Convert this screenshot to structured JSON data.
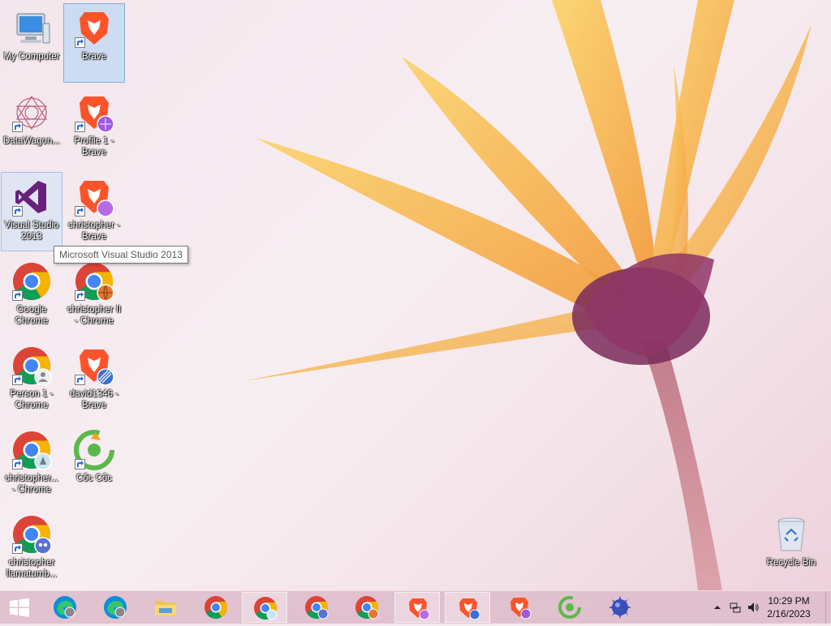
{
  "desktop": {
    "icons": [
      {
        "label": "My Computer"
      },
      {
        "label": "Brave"
      },
      {
        "label": "DataWagon..."
      },
      {
        "label": "Profile 1 - Brave"
      },
      {
        "label": "Visual Studio 2013"
      },
      {
        "label": "christopher - Brave"
      },
      {
        "label": "Google Chrome"
      },
      {
        "label": "christopher II - Chrome"
      },
      {
        "label": "Person 1 - Chrome"
      },
      {
        "label": "david1346 - Brave"
      },
      {
        "label": "christopher... - Chrome"
      },
      {
        "label": "Cốc Cốc"
      },
      {
        "label": "christopher llamatumb..."
      },
      {
        "label": "Recycle Bin"
      }
    ],
    "tooltip": "Microsoft Visual Studio 2013"
  },
  "taskbar": {
    "clock": {
      "time": "10:29 PM",
      "date": "2/16/2023"
    }
  },
  "colors": {
    "brave": "#fb542b",
    "chrome_red": "#db4437",
    "chrome_green": "#0f9d58",
    "chrome_yellow": "#f4b400",
    "chrome_blue": "#4285f4",
    "vs_purple": "#68217a",
    "coccoc_green": "#5bb84a"
  }
}
